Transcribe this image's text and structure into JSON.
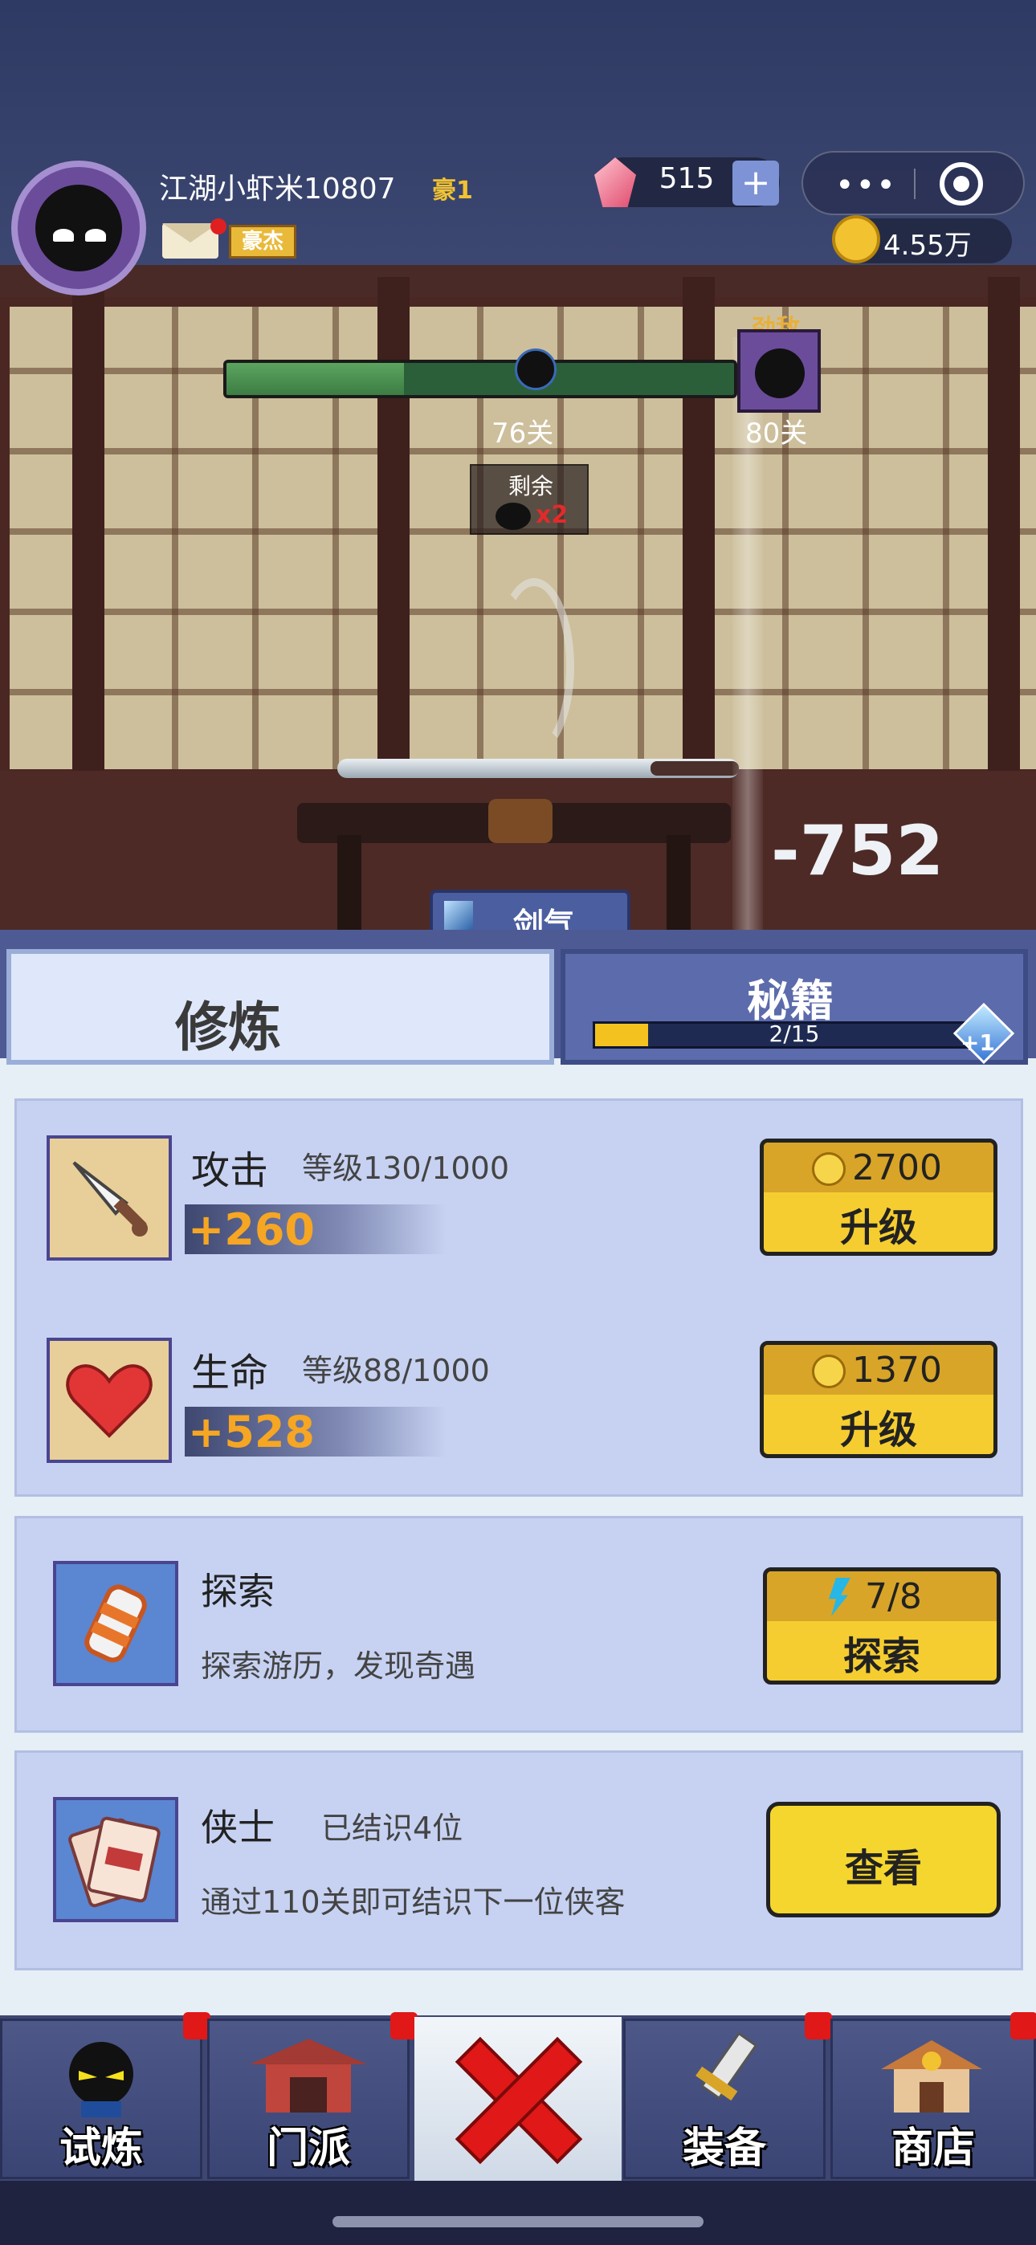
{
  "header": {
    "player_name": "江湖小虾米10807",
    "vip_level": "豪1",
    "title_badge": "豪杰",
    "gems": "515",
    "gold": "4.55万"
  },
  "battle": {
    "boss_label": "劲敌",
    "current_stage": "76关",
    "boss_stage": "80关",
    "stage_progress": 0.35,
    "remaining_label": "剩余",
    "remaining_count": "x2",
    "damage": "-752",
    "skill_label": "剑气"
  },
  "tabs": {
    "train": "修炼",
    "secret_book": "秘籍",
    "book_progress_text": "2/15",
    "book_progress": 0.1333,
    "book_bonus": "+1"
  },
  "train": {
    "attack": {
      "title": "攻击",
      "level": "等级130/1000",
      "bonus": "+260",
      "cost": "2700",
      "action": "升级"
    },
    "health": {
      "title": "生命",
      "level": "等级88/1000",
      "bonus": "+528",
      "cost": "1370",
      "action": "升级"
    }
  },
  "explore": {
    "title": "探索",
    "desc": "探索游历，发现奇遇",
    "energy": "7/8",
    "action": "探索"
  },
  "heroes": {
    "title": "侠士",
    "count_text": "已结识4位",
    "desc": "通过110关即可结识下一位侠客",
    "action": "查看"
  },
  "nav": {
    "trial": "试炼",
    "sect": "门派",
    "equip": "装备",
    "shop": "商店"
  },
  "colors": {
    "accent_gold": "#f5cd30",
    "bonus_orange": "#f6a623",
    "panel_blue": "#c7d2f2",
    "badge_red": "#e01818"
  }
}
